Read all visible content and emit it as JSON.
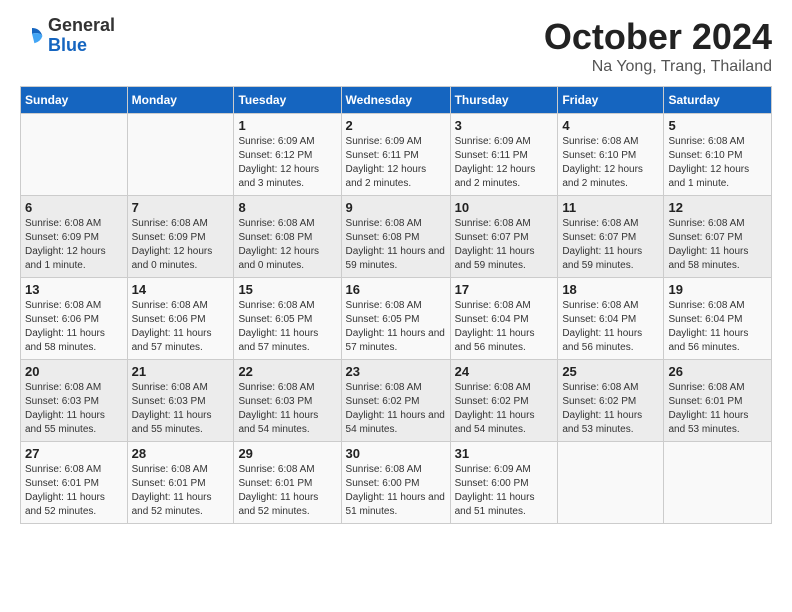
{
  "logo": {
    "general": "General",
    "blue": "Blue"
  },
  "title": "October 2024",
  "location": "Na Yong, Trang, Thailand",
  "headers": [
    "Sunday",
    "Monday",
    "Tuesday",
    "Wednesday",
    "Thursday",
    "Friday",
    "Saturday"
  ],
  "weeks": [
    [
      {
        "day": "",
        "sunrise": "",
        "sunset": "",
        "daylight": ""
      },
      {
        "day": "",
        "sunrise": "",
        "sunset": "",
        "daylight": ""
      },
      {
        "day": "1",
        "sunrise": "Sunrise: 6:09 AM",
        "sunset": "Sunset: 6:12 PM",
        "daylight": "Daylight: 12 hours and 3 minutes."
      },
      {
        "day": "2",
        "sunrise": "Sunrise: 6:09 AM",
        "sunset": "Sunset: 6:11 PM",
        "daylight": "Daylight: 12 hours and 2 minutes."
      },
      {
        "day": "3",
        "sunrise": "Sunrise: 6:09 AM",
        "sunset": "Sunset: 6:11 PM",
        "daylight": "Daylight: 12 hours and 2 minutes."
      },
      {
        "day": "4",
        "sunrise": "Sunrise: 6:08 AM",
        "sunset": "Sunset: 6:10 PM",
        "daylight": "Daylight: 12 hours and 2 minutes."
      },
      {
        "day": "5",
        "sunrise": "Sunrise: 6:08 AM",
        "sunset": "Sunset: 6:10 PM",
        "daylight": "Daylight: 12 hours and 1 minute."
      }
    ],
    [
      {
        "day": "6",
        "sunrise": "Sunrise: 6:08 AM",
        "sunset": "Sunset: 6:09 PM",
        "daylight": "Daylight: 12 hours and 1 minute."
      },
      {
        "day": "7",
        "sunrise": "Sunrise: 6:08 AM",
        "sunset": "Sunset: 6:09 PM",
        "daylight": "Daylight: 12 hours and 0 minutes."
      },
      {
        "day": "8",
        "sunrise": "Sunrise: 6:08 AM",
        "sunset": "Sunset: 6:08 PM",
        "daylight": "Daylight: 12 hours and 0 minutes."
      },
      {
        "day": "9",
        "sunrise": "Sunrise: 6:08 AM",
        "sunset": "Sunset: 6:08 PM",
        "daylight": "Daylight: 11 hours and 59 minutes."
      },
      {
        "day": "10",
        "sunrise": "Sunrise: 6:08 AM",
        "sunset": "Sunset: 6:07 PM",
        "daylight": "Daylight: 11 hours and 59 minutes."
      },
      {
        "day": "11",
        "sunrise": "Sunrise: 6:08 AM",
        "sunset": "Sunset: 6:07 PM",
        "daylight": "Daylight: 11 hours and 59 minutes."
      },
      {
        "day": "12",
        "sunrise": "Sunrise: 6:08 AM",
        "sunset": "Sunset: 6:07 PM",
        "daylight": "Daylight: 11 hours and 58 minutes."
      }
    ],
    [
      {
        "day": "13",
        "sunrise": "Sunrise: 6:08 AM",
        "sunset": "Sunset: 6:06 PM",
        "daylight": "Daylight: 11 hours and 58 minutes."
      },
      {
        "day": "14",
        "sunrise": "Sunrise: 6:08 AM",
        "sunset": "Sunset: 6:06 PM",
        "daylight": "Daylight: 11 hours and 57 minutes."
      },
      {
        "day": "15",
        "sunrise": "Sunrise: 6:08 AM",
        "sunset": "Sunset: 6:05 PM",
        "daylight": "Daylight: 11 hours and 57 minutes."
      },
      {
        "day": "16",
        "sunrise": "Sunrise: 6:08 AM",
        "sunset": "Sunset: 6:05 PM",
        "daylight": "Daylight: 11 hours and 57 minutes."
      },
      {
        "day": "17",
        "sunrise": "Sunrise: 6:08 AM",
        "sunset": "Sunset: 6:04 PM",
        "daylight": "Daylight: 11 hours and 56 minutes."
      },
      {
        "day": "18",
        "sunrise": "Sunrise: 6:08 AM",
        "sunset": "Sunset: 6:04 PM",
        "daylight": "Daylight: 11 hours and 56 minutes."
      },
      {
        "day": "19",
        "sunrise": "Sunrise: 6:08 AM",
        "sunset": "Sunset: 6:04 PM",
        "daylight": "Daylight: 11 hours and 56 minutes."
      }
    ],
    [
      {
        "day": "20",
        "sunrise": "Sunrise: 6:08 AM",
        "sunset": "Sunset: 6:03 PM",
        "daylight": "Daylight: 11 hours and 55 minutes."
      },
      {
        "day": "21",
        "sunrise": "Sunrise: 6:08 AM",
        "sunset": "Sunset: 6:03 PM",
        "daylight": "Daylight: 11 hours and 55 minutes."
      },
      {
        "day": "22",
        "sunrise": "Sunrise: 6:08 AM",
        "sunset": "Sunset: 6:03 PM",
        "daylight": "Daylight: 11 hours and 54 minutes."
      },
      {
        "day": "23",
        "sunrise": "Sunrise: 6:08 AM",
        "sunset": "Sunset: 6:02 PM",
        "daylight": "Daylight: 11 hours and 54 minutes."
      },
      {
        "day": "24",
        "sunrise": "Sunrise: 6:08 AM",
        "sunset": "Sunset: 6:02 PM",
        "daylight": "Daylight: 11 hours and 54 minutes."
      },
      {
        "day": "25",
        "sunrise": "Sunrise: 6:08 AM",
        "sunset": "Sunset: 6:02 PM",
        "daylight": "Daylight: 11 hours and 53 minutes."
      },
      {
        "day": "26",
        "sunrise": "Sunrise: 6:08 AM",
        "sunset": "Sunset: 6:01 PM",
        "daylight": "Daylight: 11 hours and 53 minutes."
      }
    ],
    [
      {
        "day": "27",
        "sunrise": "Sunrise: 6:08 AM",
        "sunset": "Sunset: 6:01 PM",
        "daylight": "Daylight: 11 hours and 52 minutes."
      },
      {
        "day": "28",
        "sunrise": "Sunrise: 6:08 AM",
        "sunset": "Sunset: 6:01 PM",
        "daylight": "Daylight: 11 hours and 52 minutes."
      },
      {
        "day": "29",
        "sunrise": "Sunrise: 6:08 AM",
        "sunset": "Sunset: 6:01 PM",
        "daylight": "Daylight: 11 hours and 52 minutes."
      },
      {
        "day": "30",
        "sunrise": "Sunrise: 6:08 AM",
        "sunset": "Sunset: 6:00 PM",
        "daylight": "Daylight: 11 hours and 51 minutes."
      },
      {
        "day": "31",
        "sunrise": "Sunrise: 6:09 AM",
        "sunset": "Sunset: 6:00 PM",
        "daylight": "Daylight: 11 hours and 51 minutes."
      },
      {
        "day": "",
        "sunrise": "",
        "sunset": "",
        "daylight": ""
      },
      {
        "day": "",
        "sunrise": "",
        "sunset": "",
        "daylight": ""
      }
    ]
  ]
}
